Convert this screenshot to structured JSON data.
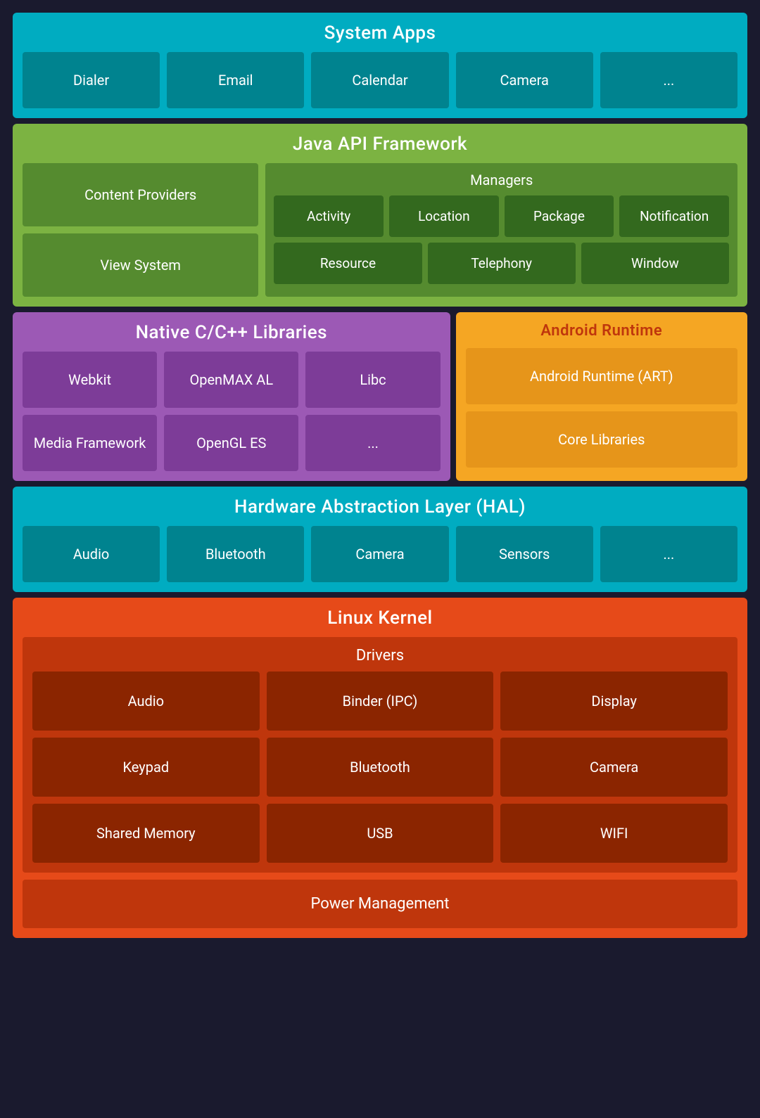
{
  "system_apps": {
    "title": "System Apps",
    "items": [
      "Dialer",
      "Email",
      "Calendar",
      "Camera",
      "..."
    ]
  },
  "java_api": {
    "title": "Java API Framework",
    "left": [
      "Content Providers",
      "View System"
    ],
    "managers": {
      "title": "Managers",
      "row1": [
        "Activity",
        "Location",
        "Package",
        "Notification"
      ],
      "row2": [
        "Resource",
        "Telephony",
        "Window"
      ]
    }
  },
  "native_libs": {
    "title": "Native C/C++ Libraries",
    "row1": [
      "Webkit",
      "OpenMAX AL",
      "Libc"
    ],
    "row2": [
      "Media Framework",
      "OpenGL ES",
      "..."
    ]
  },
  "android_runtime": {
    "title": "Android Runtime",
    "items": [
      "Android Runtime (ART)",
      "Core Libraries"
    ]
  },
  "hal": {
    "title": "Hardware Abstraction Layer (HAL)",
    "items": [
      "Audio",
      "Bluetooth",
      "Camera",
      "Sensors",
      "..."
    ]
  },
  "linux_kernel": {
    "title": "Linux Kernel",
    "drivers": {
      "subtitle": "Drivers",
      "row1": [
        "Audio",
        "Binder (IPC)",
        "Display"
      ],
      "row2": [
        "Keypad",
        "Bluetooth",
        "Camera"
      ],
      "row3": [
        "Shared Memory",
        "USB",
        "WIFI"
      ]
    },
    "power_mgmt": "Power Management"
  }
}
